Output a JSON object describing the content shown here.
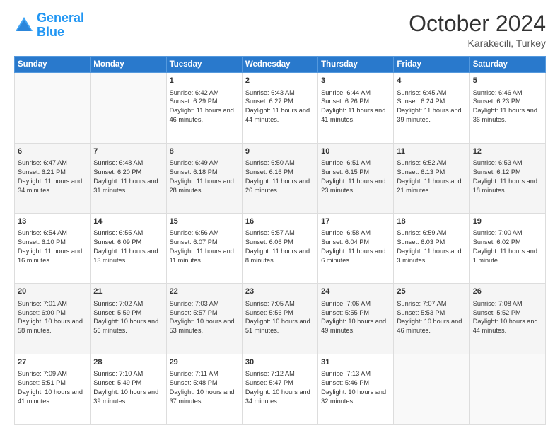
{
  "header": {
    "logo_general": "General",
    "logo_blue": "Blue",
    "month_title": "October 2024",
    "location": "Karakecili, Turkey"
  },
  "days_of_week": [
    "Sunday",
    "Monday",
    "Tuesday",
    "Wednesday",
    "Thursday",
    "Friday",
    "Saturday"
  ],
  "weeks": [
    [
      {
        "day": "",
        "sunrise": "",
        "sunset": "",
        "daylight": ""
      },
      {
        "day": "",
        "sunrise": "",
        "sunset": "",
        "daylight": ""
      },
      {
        "day": "1",
        "sunrise": "Sunrise: 6:42 AM",
        "sunset": "Sunset: 6:29 PM",
        "daylight": "Daylight: 11 hours and 46 minutes."
      },
      {
        "day": "2",
        "sunrise": "Sunrise: 6:43 AM",
        "sunset": "Sunset: 6:27 PM",
        "daylight": "Daylight: 11 hours and 44 minutes."
      },
      {
        "day": "3",
        "sunrise": "Sunrise: 6:44 AM",
        "sunset": "Sunset: 6:26 PM",
        "daylight": "Daylight: 11 hours and 41 minutes."
      },
      {
        "day": "4",
        "sunrise": "Sunrise: 6:45 AM",
        "sunset": "Sunset: 6:24 PM",
        "daylight": "Daylight: 11 hours and 39 minutes."
      },
      {
        "day": "5",
        "sunrise": "Sunrise: 6:46 AM",
        "sunset": "Sunset: 6:23 PM",
        "daylight": "Daylight: 11 hours and 36 minutes."
      }
    ],
    [
      {
        "day": "6",
        "sunrise": "Sunrise: 6:47 AM",
        "sunset": "Sunset: 6:21 PM",
        "daylight": "Daylight: 11 hours and 34 minutes."
      },
      {
        "day": "7",
        "sunrise": "Sunrise: 6:48 AM",
        "sunset": "Sunset: 6:20 PM",
        "daylight": "Daylight: 11 hours and 31 minutes."
      },
      {
        "day": "8",
        "sunrise": "Sunrise: 6:49 AM",
        "sunset": "Sunset: 6:18 PM",
        "daylight": "Daylight: 11 hours and 28 minutes."
      },
      {
        "day": "9",
        "sunrise": "Sunrise: 6:50 AM",
        "sunset": "Sunset: 6:16 PM",
        "daylight": "Daylight: 11 hours and 26 minutes."
      },
      {
        "day": "10",
        "sunrise": "Sunrise: 6:51 AM",
        "sunset": "Sunset: 6:15 PM",
        "daylight": "Daylight: 11 hours and 23 minutes."
      },
      {
        "day": "11",
        "sunrise": "Sunrise: 6:52 AM",
        "sunset": "Sunset: 6:13 PM",
        "daylight": "Daylight: 11 hours and 21 minutes."
      },
      {
        "day": "12",
        "sunrise": "Sunrise: 6:53 AM",
        "sunset": "Sunset: 6:12 PM",
        "daylight": "Daylight: 11 hours and 18 minutes."
      }
    ],
    [
      {
        "day": "13",
        "sunrise": "Sunrise: 6:54 AM",
        "sunset": "Sunset: 6:10 PM",
        "daylight": "Daylight: 11 hours and 16 minutes."
      },
      {
        "day": "14",
        "sunrise": "Sunrise: 6:55 AM",
        "sunset": "Sunset: 6:09 PM",
        "daylight": "Daylight: 11 hours and 13 minutes."
      },
      {
        "day": "15",
        "sunrise": "Sunrise: 6:56 AM",
        "sunset": "Sunset: 6:07 PM",
        "daylight": "Daylight: 11 hours and 11 minutes."
      },
      {
        "day": "16",
        "sunrise": "Sunrise: 6:57 AM",
        "sunset": "Sunset: 6:06 PM",
        "daylight": "Daylight: 11 hours and 8 minutes."
      },
      {
        "day": "17",
        "sunrise": "Sunrise: 6:58 AM",
        "sunset": "Sunset: 6:04 PM",
        "daylight": "Daylight: 11 hours and 6 minutes."
      },
      {
        "day": "18",
        "sunrise": "Sunrise: 6:59 AM",
        "sunset": "Sunset: 6:03 PM",
        "daylight": "Daylight: 11 hours and 3 minutes."
      },
      {
        "day": "19",
        "sunrise": "Sunrise: 7:00 AM",
        "sunset": "Sunset: 6:02 PM",
        "daylight": "Daylight: 11 hours and 1 minute."
      }
    ],
    [
      {
        "day": "20",
        "sunrise": "Sunrise: 7:01 AM",
        "sunset": "Sunset: 6:00 PM",
        "daylight": "Daylight: 10 hours and 58 minutes."
      },
      {
        "day": "21",
        "sunrise": "Sunrise: 7:02 AM",
        "sunset": "Sunset: 5:59 PM",
        "daylight": "Daylight: 10 hours and 56 minutes."
      },
      {
        "day": "22",
        "sunrise": "Sunrise: 7:03 AM",
        "sunset": "Sunset: 5:57 PM",
        "daylight": "Daylight: 10 hours and 53 minutes."
      },
      {
        "day": "23",
        "sunrise": "Sunrise: 7:05 AM",
        "sunset": "Sunset: 5:56 PM",
        "daylight": "Daylight: 10 hours and 51 minutes."
      },
      {
        "day": "24",
        "sunrise": "Sunrise: 7:06 AM",
        "sunset": "Sunset: 5:55 PM",
        "daylight": "Daylight: 10 hours and 49 minutes."
      },
      {
        "day": "25",
        "sunrise": "Sunrise: 7:07 AM",
        "sunset": "Sunset: 5:53 PM",
        "daylight": "Daylight: 10 hours and 46 minutes."
      },
      {
        "day": "26",
        "sunrise": "Sunrise: 7:08 AM",
        "sunset": "Sunset: 5:52 PM",
        "daylight": "Daylight: 10 hours and 44 minutes."
      }
    ],
    [
      {
        "day": "27",
        "sunrise": "Sunrise: 7:09 AM",
        "sunset": "Sunset: 5:51 PM",
        "daylight": "Daylight: 10 hours and 41 minutes."
      },
      {
        "day": "28",
        "sunrise": "Sunrise: 7:10 AM",
        "sunset": "Sunset: 5:49 PM",
        "daylight": "Daylight: 10 hours and 39 minutes."
      },
      {
        "day": "29",
        "sunrise": "Sunrise: 7:11 AM",
        "sunset": "Sunset: 5:48 PM",
        "daylight": "Daylight: 10 hours and 37 minutes."
      },
      {
        "day": "30",
        "sunrise": "Sunrise: 7:12 AM",
        "sunset": "Sunset: 5:47 PM",
        "daylight": "Daylight: 10 hours and 34 minutes."
      },
      {
        "day": "31",
        "sunrise": "Sunrise: 7:13 AM",
        "sunset": "Sunset: 5:46 PM",
        "daylight": "Daylight: 10 hours and 32 minutes."
      },
      {
        "day": "",
        "sunrise": "",
        "sunset": "",
        "daylight": ""
      },
      {
        "day": "",
        "sunrise": "",
        "sunset": "",
        "daylight": ""
      }
    ]
  ]
}
